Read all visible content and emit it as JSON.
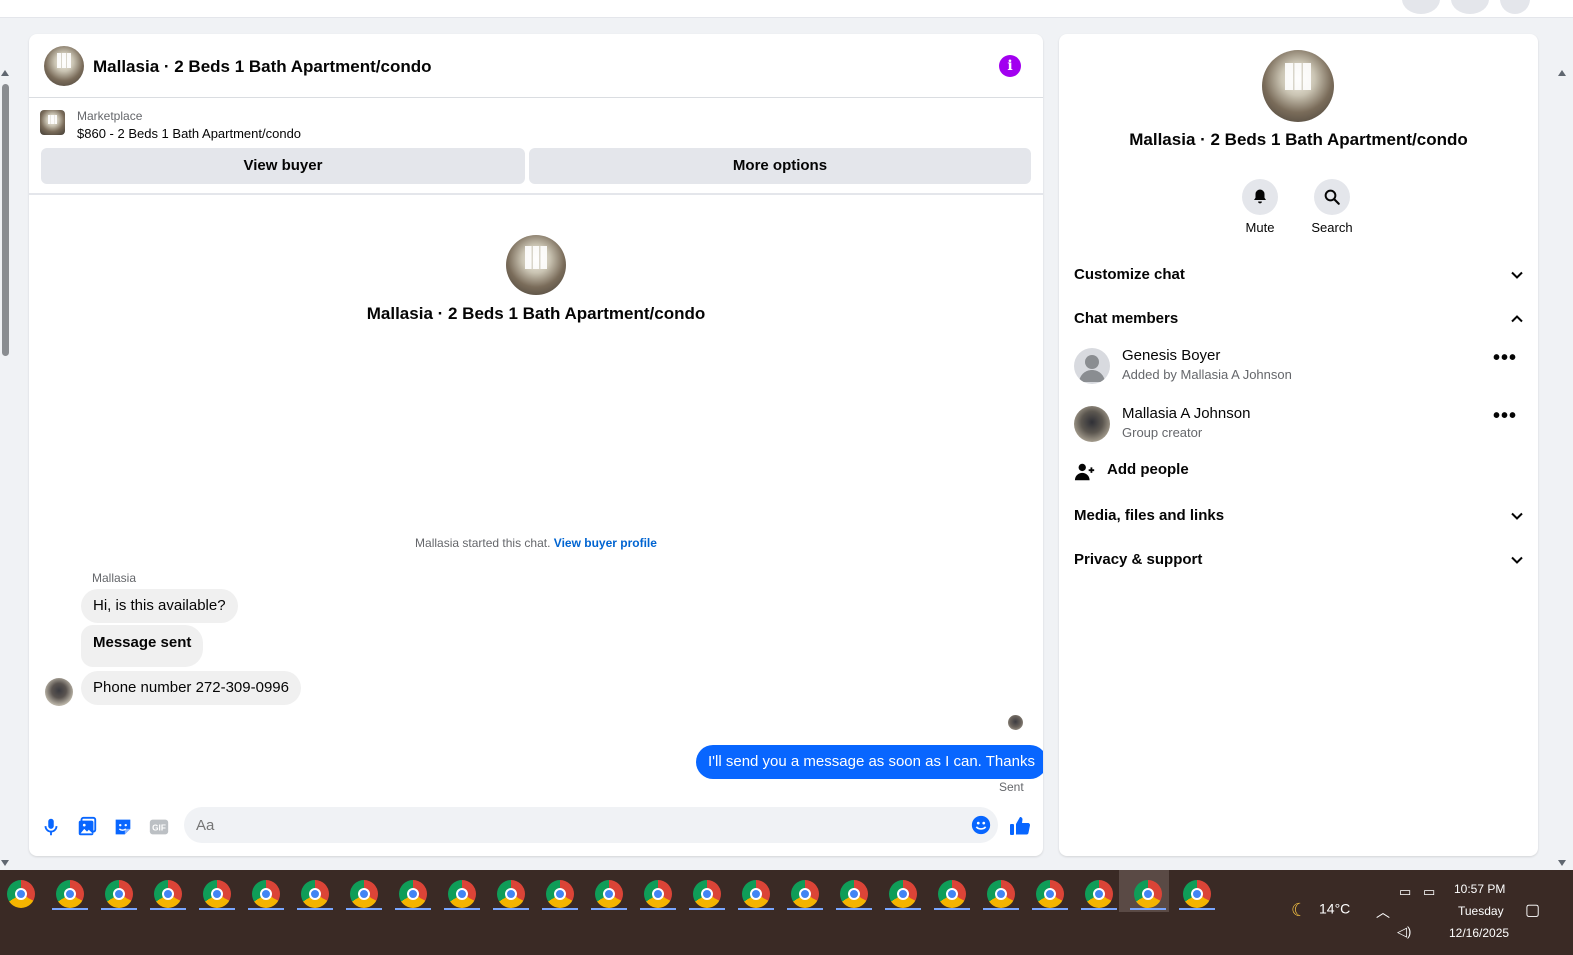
{
  "chat": {
    "header_title": "Mallasia · 2 Beds 1 Bath Apartment/condo",
    "marketplace_label": "Marketplace",
    "listing": "$860 - 2 Beds 1 Bath Apartment/condo",
    "view_buyer": "View buyer",
    "more_options": "More options",
    "conversation_title": "Mallasia · 2 Beds 1 Bath Apartment/condo",
    "started_text": "Mallasia started this chat.",
    "view_buyer_profile": "View buyer profile",
    "sender_name": "Mallasia",
    "messages": [
      "Hi, is this available?",
      "Message sent",
      "Phone number 272-309-0996"
    ],
    "my_message": "I'll send you a message as soon as I can. Thanks",
    "sent_status": "Sent",
    "composer_placeholder": "Aa"
  },
  "panel": {
    "title": "Mallasia · 2 Beds 1 Bath Apartment/condo",
    "mute_label": "Mute",
    "search_label": "Search",
    "customize_chat": "Customize chat",
    "chat_members": "Chat members",
    "members": [
      {
        "name": "Genesis Boyer",
        "subtitle": "Added by Mallasia A Johnson"
      },
      {
        "name": "Mallasia A Johnson",
        "subtitle": "Group creator"
      }
    ],
    "add_people": "Add people",
    "media_files_links": "Media, files and links",
    "privacy_support": "Privacy & support"
  },
  "taskbar": {
    "temperature": "14°C",
    "time": "10:57 PM",
    "day": "Tuesday",
    "date": "12/16/2025"
  },
  "colors": {
    "accent": "#0866ff",
    "info": "#a200f0",
    "taskbar": "#3a2a25"
  }
}
